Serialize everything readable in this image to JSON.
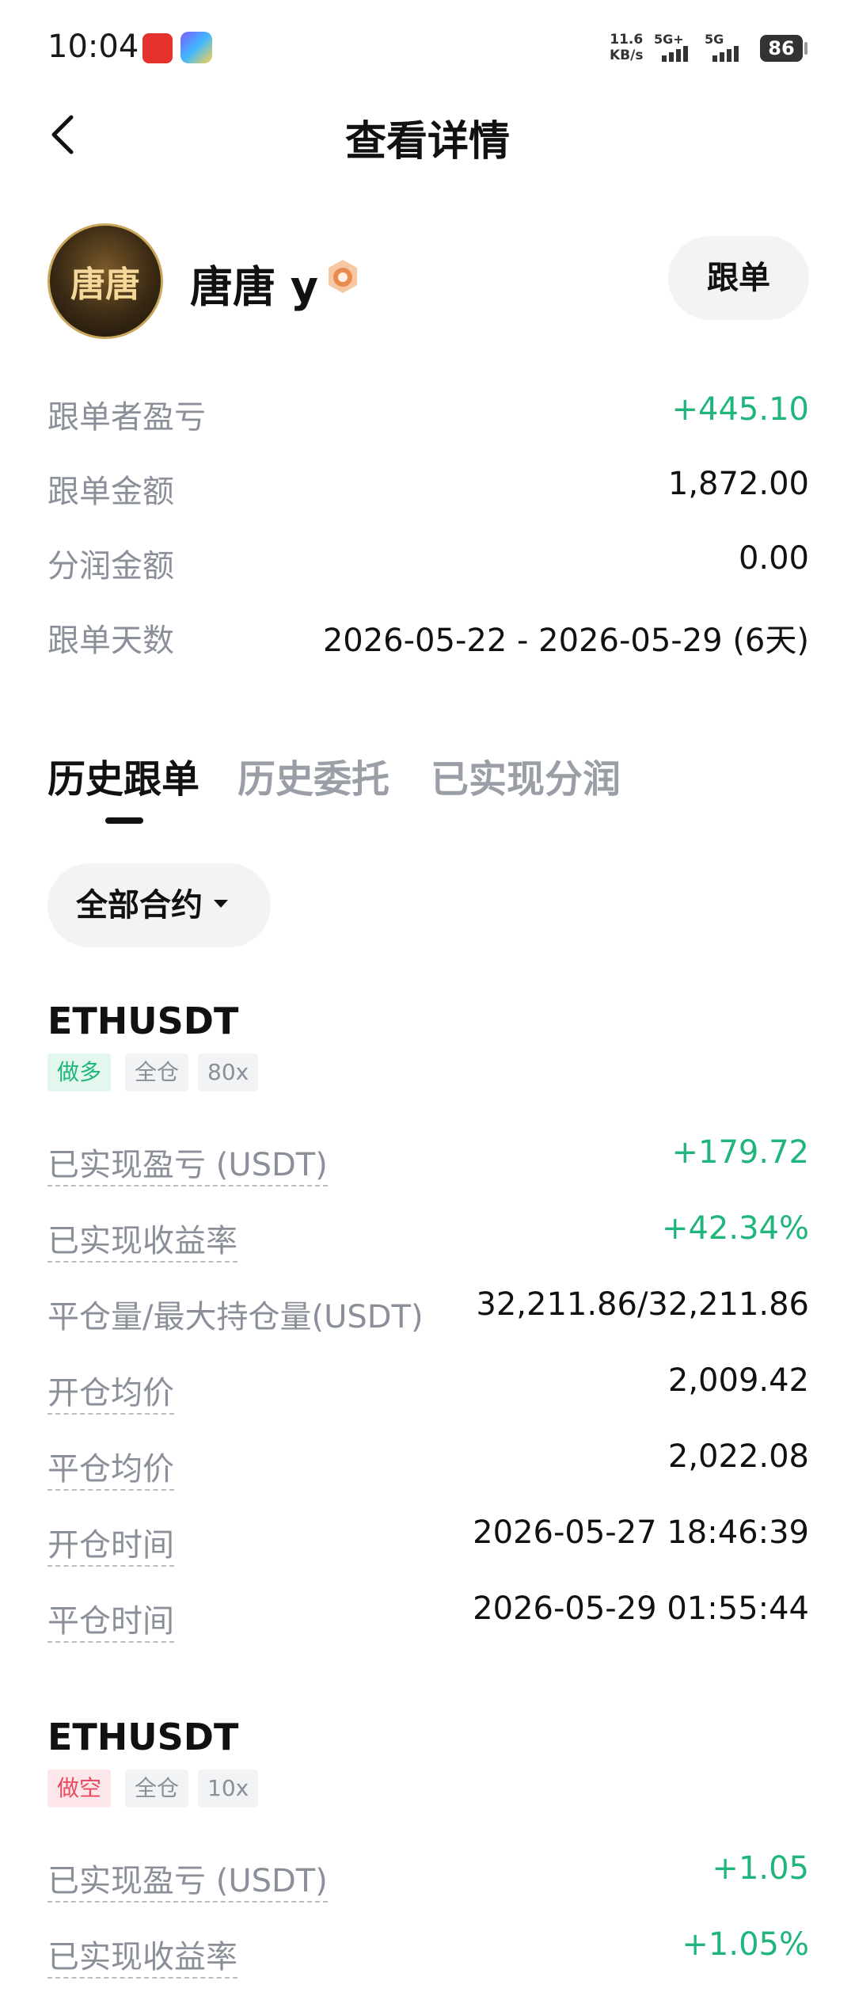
{
  "status": {
    "time": "10:04",
    "net_speed_top": "11.6",
    "net_speed_bottom": "KB/s",
    "sig1": "5G+",
    "sig2": "5G",
    "battery": "86"
  },
  "header": {
    "title": "查看详情"
  },
  "profile": {
    "name": "唐唐 y",
    "avatar_text": "唐唐",
    "follow_label": "跟单"
  },
  "stats": [
    {
      "label": "跟单者盈亏",
      "value": "+445.10"
    },
    {
      "label": "跟单金额",
      "value": "1,872.00"
    },
    {
      "label": "分润金额",
      "value": "0.00"
    },
    {
      "label": "跟单天数",
      "value": "2026-05-22 - 2026-05-29 (6天)"
    }
  ],
  "tabs": [
    "历史跟单",
    "历史委托",
    "已实现分润"
  ],
  "filter": {
    "label": "全部合约"
  },
  "trades": [
    {
      "symbol": "ETHUSDT",
      "tags": [
        "做多",
        "全仓",
        "80x"
      ],
      "rows": [
        {
          "label": "已实现盈亏 (USDT)",
          "value": "+179.72"
        },
        {
          "label": "已实现收益率",
          "value": "+42.34%"
        },
        {
          "label": "平仓量/最大持仓量(USDT)",
          "value": "32,211.86/32,211.86"
        },
        {
          "label": "开仓均价",
          "value": "2,009.42"
        },
        {
          "label": "平仓均价",
          "value": "2,022.08"
        },
        {
          "label": "开仓时间",
          "value": "2026-05-27 18:46:39"
        },
        {
          "label": "平仓时间",
          "value": "2026-05-29 01:55:44"
        }
      ]
    },
    {
      "symbol": "ETHUSDT",
      "tags": [
        "做空",
        "全仓",
        "10x"
      ],
      "rows": [
        {
          "label": "已实现盈亏 (USDT)",
          "value": "+1.05"
        },
        {
          "label": "已实现收益率",
          "value": "+1.05%"
        }
      ]
    }
  ],
  "colors": {
    "profit_green": "#1fb57b",
    "short_red": "#e94a60",
    "muted_gray": "#8a8f99"
  },
  "icons": {
    "back": "chevron-left-icon",
    "medal": "bronze-medal-icon",
    "dropdown": "caret-down-icon"
  }
}
